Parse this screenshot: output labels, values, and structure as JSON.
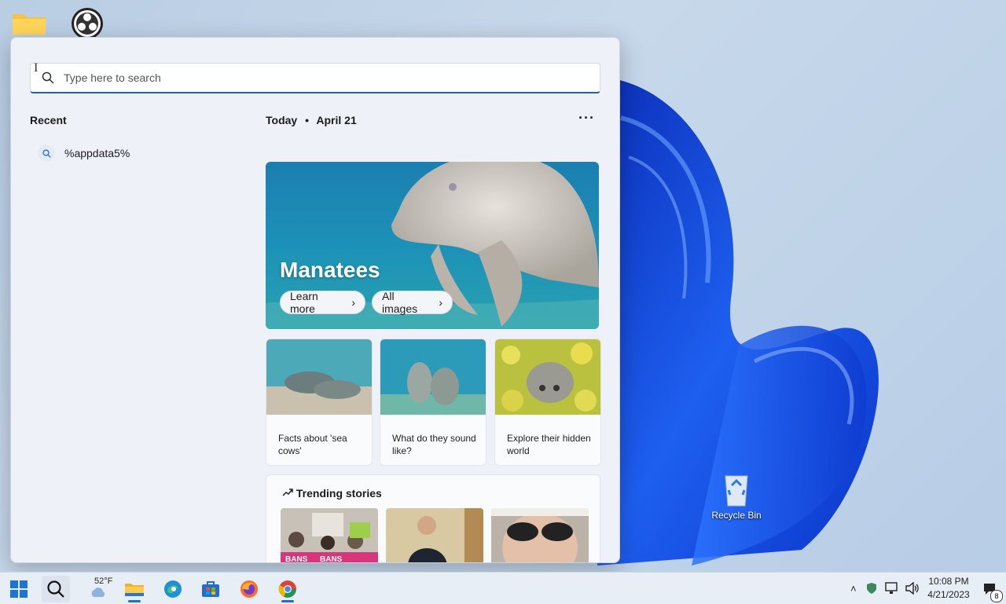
{
  "desktop": {
    "recycle_bin_label": "Recycle Bin"
  },
  "search": {
    "placeholder": "Type here to search",
    "value": ""
  },
  "recent": {
    "title": "Recent",
    "items": [
      {
        "label": "%appdata5%"
      }
    ]
  },
  "today": {
    "label": "Today",
    "separator": "•",
    "date": "April 21",
    "more_label": "···",
    "hero": {
      "title": "Manatees",
      "learn_more": "Learn more",
      "all_images": "All images"
    },
    "cards": [
      {
        "caption": "Facts about 'sea cows'"
      },
      {
        "caption": "What do they sound like?"
      },
      {
        "caption": "Explore their hidden world"
      }
    ],
    "trending": {
      "title": "Trending stories",
      "thumb_text_1": "BANS",
      "thumb_text_2": "BANS"
    }
  },
  "taskbar": {
    "weather": "52°F",
    "time": "10:08 PM",
    "date": "4/21/2023",
    "notification_count": "8"
  },
  "colors": {
    "accent": "#1f5fbf",
    "bloom": "#1a4fd6"
  }
}
